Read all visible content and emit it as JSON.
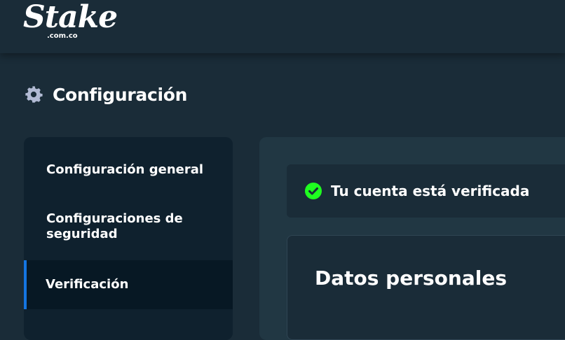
{
  "brand": {
    "logo_text": "Stake",
    "logo_domain": ".com.co"
  },
  "page": {
    "title": "Configuración",
    "title_icon": "gear-icon"
  },
  "sidebar": {
    "items": [
      {
        "label": "Configuración general",
        "active": false
      },
      {
        "label": "Configuraciones de seguridad",
        "active": false
      },
      {
        "label": "Verificación",
        "active": true
      }
    ]
  },
  "main": {
    "verified_banner": {
      "icon": "check-circle-icon",
      "text": "Tu cuenta está verificada"
    },
    "personal_data": {
      "title": "Datos personales"
    }
  },
  "colors": {
    "background": "#1a2c38",
    "sidebar": "#0f212e",
    "active_item": "#071824",
    "active_accent": "#1475e1",
    "content": "#213743",
    "success": "#1fff20"
  }
}
